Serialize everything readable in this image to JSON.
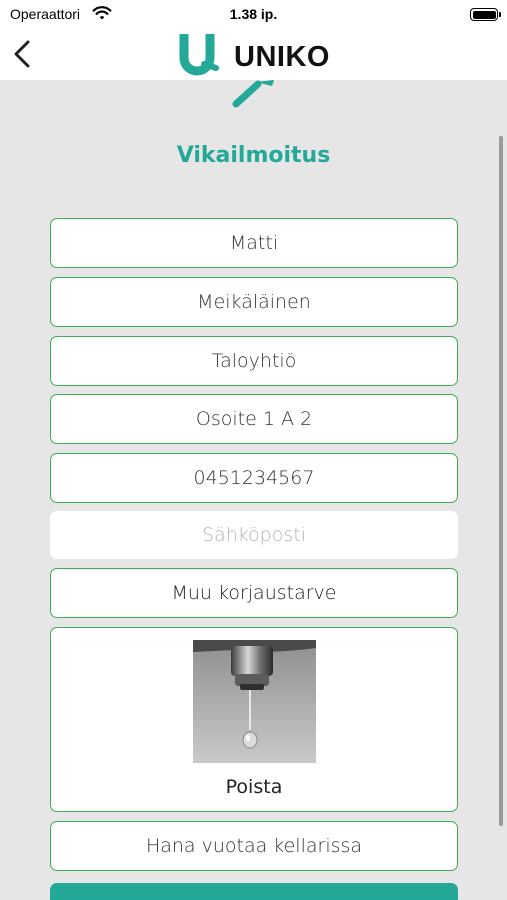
{
  "status_bar": {
    "carrier": "Operaattori",
    "time": "1.38 ip.",
    "wifi_icon": "wifi-icon",
    "battery_icon": "battery-icon"
  },
  "nav_bar": {
    "back_icon": "chevron-left-icon",
    "logo_text": "UNIKO"
  },
  "page": {
    "title": "Vikailmoitus"
  },
  "form": {
    "first_name": "Matti",
    "last_name": "Meikäläinen",
    "housing_company": "Taloyhtiö",
    "address": "Osoite 1 A 2",
    "phone": "0451234567",
    "email_placeholder": "Sähköposti",
    "repair_type": "Muu korjaustarve",
    "remove_label": "Poista",
    "description": "Hana vuotaa kellarissa"
  },
  "colors": {
    "accent": "#24a898",
    "field_border": "#3fae52",
    "background": "#e6e6e6"
  }
}
